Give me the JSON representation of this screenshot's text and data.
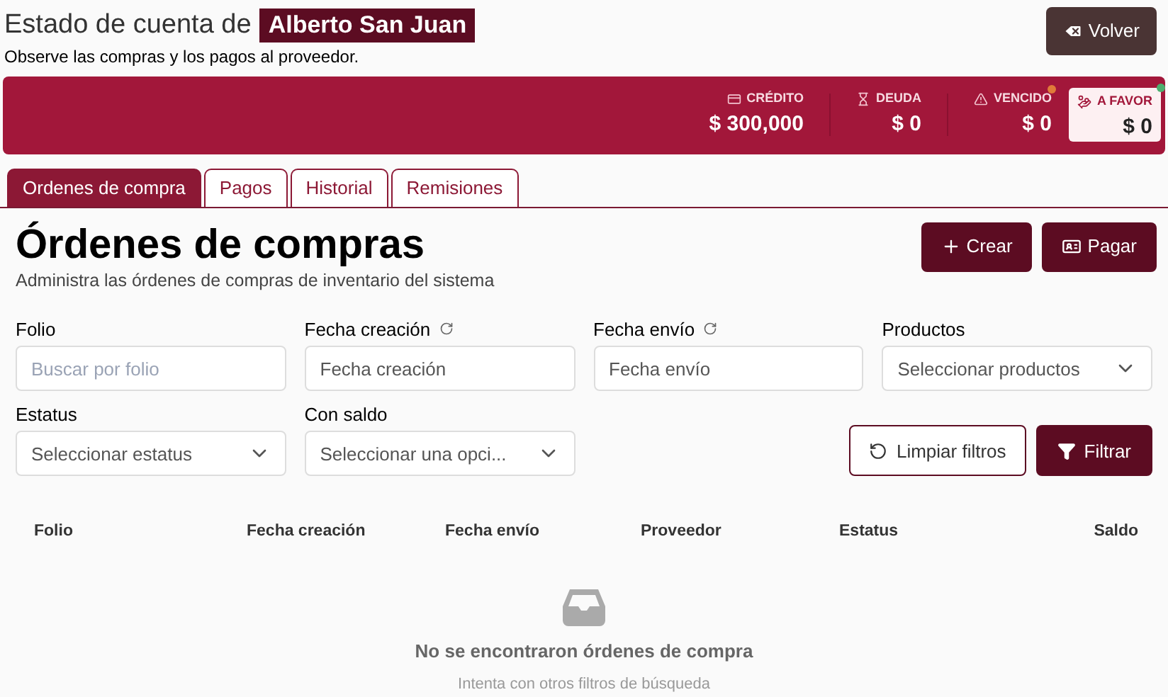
{
  "header": {
    "title": "Estado de cuenta de",
    "name": "Alberto San Juan",
    "subtitle": "Observe las compras y los pagos al proveedor.",
    "back_button": "Volver"
  },
  "summary": [
    {
      "kind": "credit",
      "label": "CRÉDITO",
      "value": "$ 300,000",
      "selected": false
    },
    {
      "kind": "debt",
      "label": "DEUDA",
      "value": "$ 0",
      "selected": false
    },
    {
      "kind": "overdue",
      "label": "VENCIDO",
      "value": "$ 0",
      "selected": false,
      "color": "#e07b39"
    },
    {
      "kind": "favor",
      "label": "A FAVOR",
      "value": "$ 0",
      "selected": true,
      "color": "#4caf6e"
    }
  ],
  "tabs": [
    {
      "label": "Ordenes de compra",
      "selected": true
    },
    {
      "label": "Pagos",
      "selected": false
    },
    {
      "label": "Historial",
      "selected": false
    },
    {
      "label": "Remisiones",
      "selected": false
    }
  ],
  "page": {
    "title": "Órdenes de compras",
    "subtitle": "Administra las órdenes de compras de inventario del sistema",
    "actions": [
      {
        "kind": "create",
        "label": "Crear"
      },
      {
        "kind": "pay",
        "label": "Pagar"
      }
    ]
  },
  "filters": [
    {
      "label": "Folio",
      "kind": "text",
      "placeholder": "Buscar por folio",
      "resettable": false
    },
    {
      "label": "Fecha creación",
      "kind": "text",
      "placeholder": "Fecha creación",
      "resettable": true
    },
    {
      "label": "Fecha envío",
      "kind": "text",
      "placeholder": "Fecha envío",
      "resettable": true
    },
    {
      "label": "Productos",
      "kind": "select",
      "placeholder": "Seleccionar productos",
      "resettable": false
    },
    {
      "label": "Estatus",
      "kind": "select",
      "placeholder": "Seleccionar estatus",
      "resettable": false
    },
    {
      "label": "Con saldo",
      "kind": "select",
      "placeholder": "Seleccionar una opci...",
      "resettable": false
    }
  ],
  "filter_actions": [
    {
      "kind": "clear",
      "label": "Limpiar filtros"
    },
    {
      "kind": "apply",
      "label": "Filtrar"
    }
  ],
  "table": {
    "columns": [
      "Folio",
      "Fecha creación",
      "Fecha envío",
      "Proveedor",
      "Estatus",
      "Saldo"
    ],
    "empty_title": "No se encontraron órdenes de compra",
    "empty_hint": "Intenta con otros filtros de búsqueda"
  }
}
